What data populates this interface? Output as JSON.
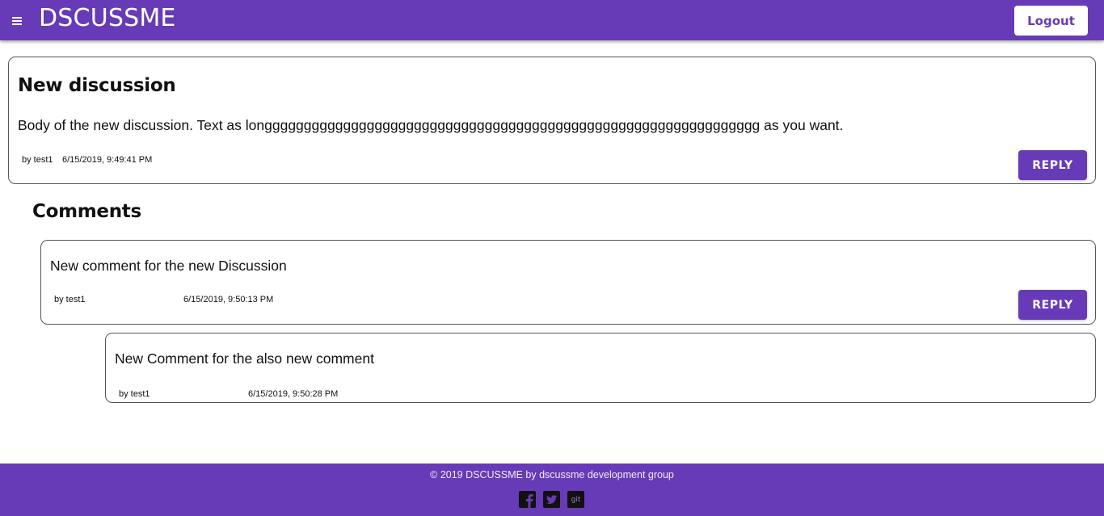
{
  "header": {
    "menu_icon": "hamburger-icon",
    "brand": "DSCUSSME",
    "logout_label": "Logout"
  },
  "discussion": {
    "title": "New discussion",
    "body": "Body of the new discussion. Text as longgggggggggggggggggggggggggggggggggggggggggggggggggggggggggggggg as you want.",
    "author": "by test1",
    "date": "6/15/2019, 9:49:41 PM",
    "reply_label": "REPLY"
  },
  "comments_heading": "Comments",
  "comments": [
    {
      "text": "New comment for the new Discussion",
      "author": "by test1",
      "date": "6/15/2019, 9:50:13 PM",
      "reply_label": "REPLY"
    },
    {
      "text": "New Comment for the also new comment",
      "author": "by test1",
      "date": "6/15/2019, 9:50:28 PM"
    }
  ],
  "footer": {
    "copyright": "© 2019 DSCUSSME by dscussme development group",
    "social": [
      {
        "icon": "facebook-icon"
      },
      {
        "icon": "twitter-icon"
      },
      {
        "icon": "git-icon",
        "text": "git"
      }
    ]
  },
  "colors": {
    "primary": "#673ab7",
    "white": "#ffffff",
    "text": "#111111",
    "border": "#555555"
  }
}
